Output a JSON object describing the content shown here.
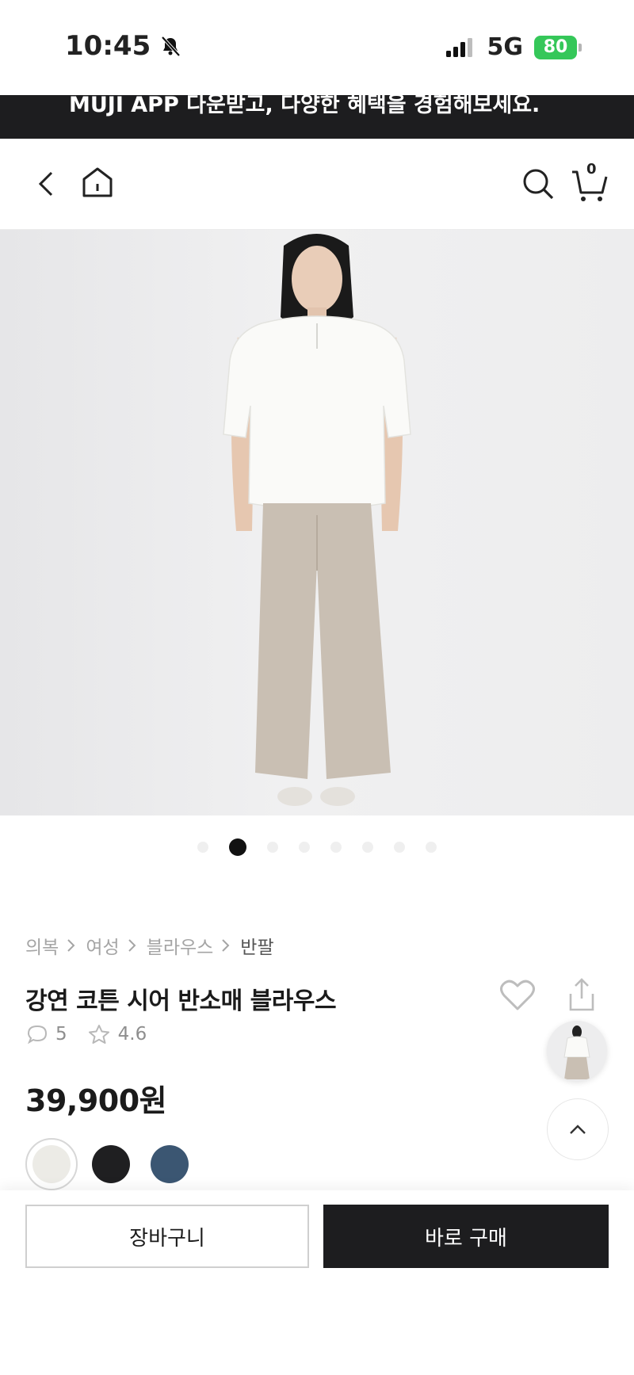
{
  "status_bar": {
    "time": "10:45",
    "network": "5G",
    "battery": "80"
  },
  "promo": {
    "text": "MUJI APP 다운받고, 다양한 혜택을 경험해보세요."
  },
  "header": {
    "cart_count": "0"
  },
  "gallery": {
    "total_images": 8,
    "active_index": 1
  },
  "breadcrumb": [
    "의복",
    "여성",
    "블라우스",
    "반팔"
  ],
  "product": {
    "title": "강연 코튼 시어 반소매 블라우스",
    "review_count": "5",
    "rating": "4.6",
    "price": "39,900원"
  },
  "colors": [
    {
      "name": "off-white",
      "hex": "#ecebe6",
      "selected": true
    },
    {
      "name": "black",
      "hex": "#1f1f21",
      "selected": false
    },
    {
      "name": "navy",
      "hex": "#3b5672",
      "selected": false
    }
  ],
  "actions": {
    "add_to_cart": "장바구니",
    "buy_now": "바로 구매"
  }
}
